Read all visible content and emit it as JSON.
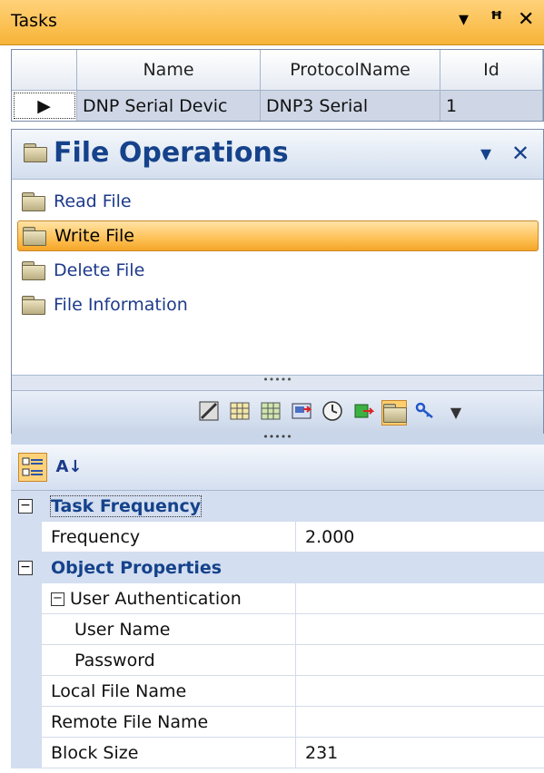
{
  "titlebar": {
    "title": "Tasks",
    "dropdown_glyph": "▾",
    "pin_glyph": "ꟸ",
    "close_glyph": "✕"
  },
  "grid": {
    "columns": [
      "",
      "Name",
      "ProtocolName",
      "Id"
    ],
    "rows": [
      {
        "indicator": "▶",
        "name": "DNP Serial Devic",
        "protocol": "DNP3 Serial",
        "id": "1"
      }
    ]
  },
  "file_operations": {
    "title": "File Operations",
    "options_glyph": "▾",
    "close_glyph": "✕",
    "items": [
      {
        "label": "Read File",
        "icon": "folder-icon",
        "selected": false
      },
      {
        "label": "Write File",
        "icon": "folder-icon",
        "selected": true
      },
      {
        "label": "Delete File",
        "icon": "folder-icon",
        "selected": false
      },
      {
        "label": "File Information",
        "icon": "folder-icon",
        "selected": false
      }
    ],
    "toolbar_icons": [
      "edit-icon",
      "table-icon",
      "table-green-icon",
      "transfer-icon",
      "clock-icon",
      "move-icon",
      "folder-icon",
      "key-icon",
      "chevron-down-icon"
    ],
    "splitter_glyph": "•••••"
  },
  "property_grid": {
    "toolbar": {
      "categorized_icon": "categorized-icon",
      "sort_az_icon": "sort-az-icon",
      "sort_glyph": "A↓"
    },
    "rows": [
      {
        "type": "category",
        "label": "Task Frequency",
        "expander": "−"
      },
      {
        "type": "property",
        "name": "Frequency",
        "value": "2.000",
        "indent": 0
      },
      {
        "type": "category",
        "label": "Object Properties",
        "expander": "−"
      },
      {
        "type": "property",
        "name": "User Authentication",
        "value": "",
        "indent": 0,
        "expander": "−"
      },
      {
        "type": "property",
        "name": "User Name",
        "value": "",
        "indent": 1
      },
      {
        "type": "property",
        "name": "Password",
        "value": "",
        "indent": 1
      },
      {
        "type": "property",
        "name": "Local File Name",
        "value": "",
        "indent": 0
      },
      {
        "type": "property",
        "name": "Remote File Name",
        "value": "",
        "indent": 0
      },
      {
        "type": "property",
        "name": "Block Size",
        "value": "231",
        "indent": 0
      }
    ]
  },
  "colors": {
    "title_bar": "#f7b437",
    "accent_blue": "#15428b",
    "selection": "#ffc45c"
  }
}
